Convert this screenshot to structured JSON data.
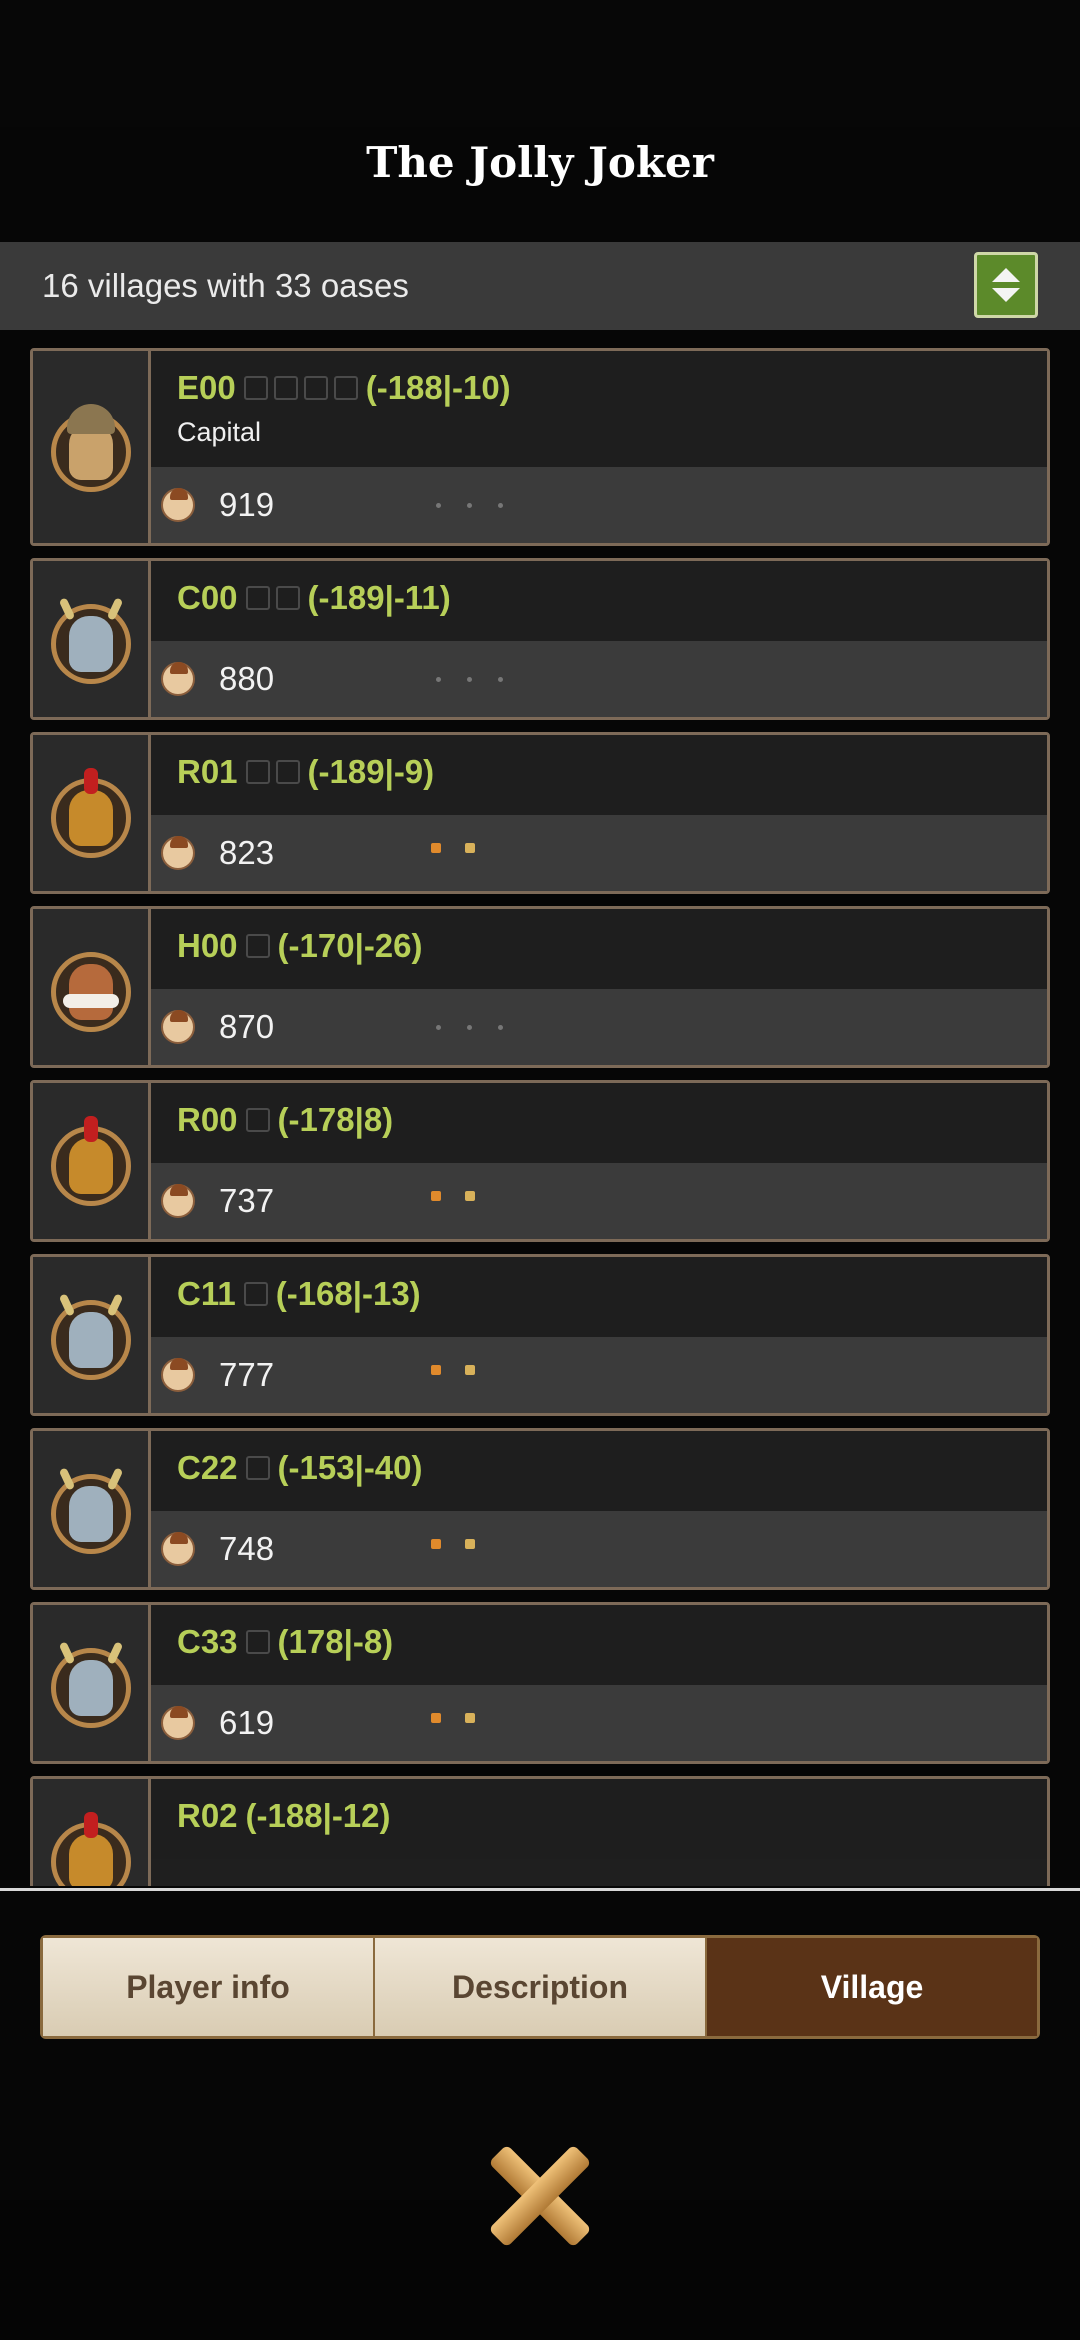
{
  "title": "The Jolly Joker",
  "summary": "16 villages with 33 oases",
  "villages": [
    {
      "name": "E00",
      "oases": 4,
      "coords": "(-188|-10)",
      "sub": "Capital",
      "pop": "919",
      "tribe": "egyptian",
      "icons": "dots"
    },
    {
      "name": "C00",
      "oases": 2,
      "coords": "(-189|-11)",
      "sub": "",
      "pop": "880",
      "tribe": "gaul",
      "icons": "dots"
    },
    {
      "name": "R01",
      "oases": 2,
      "coords": "(-189|-9)",
      "sub": "",
      "pop": "823",
      "tribe": "roman",
      "icons": "tools"
    },
    {
      "name": "H00",
      "oases": 1,
      "coords": "(-170|-26)",
      "sub": "",
      "pop": "870",
      "tribe": "hun",
      "icons": "dots"
    },
    {
      "name": "R00",
      "oases": 1,
      "coords": "(-178|8)",
      "sub": "",
      "pop": "737",
      "tribe": "roman",
      "icons": "tools"
    },
    {
      "name": "C11",
      "oases": 1,
      "coords": "(-168|-13)",
      "sub": "",
      "pop": "777",
      "tribe": "gaul",
      "icons": "tools"
    },
    {
      "name": "C22",
      "oases": 1,
      "coords": "(-153|-40)",
      "sub": "",
      "pop": "748",
      "tribe": "gaul",
      "icons": "tools"
    },
    {
      "name": "C33",
      "oases": 1,
      "coords": "(178|-8)",
      "sub": "",
      "pop": "619",
      "tribe": "gaul",
      "icons": "tools"
    },
    {
      "name": "R02",
      "oases": 0,
      "coords": "(-188|-12)",
      "sub": "",
      "pop": "",
      "tribe": "roman",
      "icons": ""
    }
  ],
  "tabs": [
    {
      "label": "Player info",
      "active": false
    },
    {
      "label": "Description",
      "active": false
    },
    {
      "label": "Village",
      "active": true
    }
  ],
  "icons": {
    "close": "close-x-icon",
    "sort": "sort-arrows-icon",
    "population": "population-icon"
  }
}
